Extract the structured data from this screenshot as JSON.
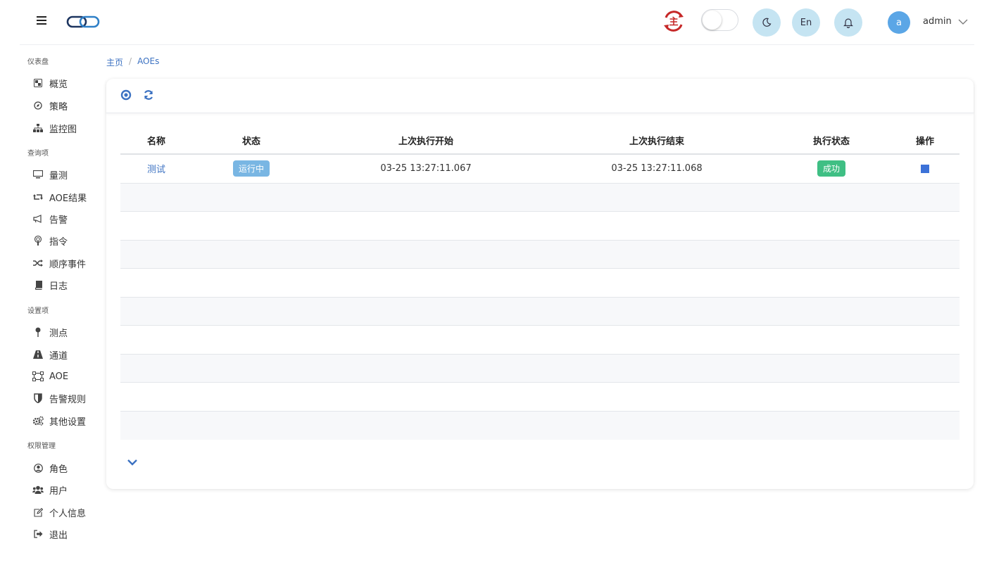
{
  "header": {
    "lang_label": "En",
    "username": "admin",
    "avatar_letter": "a",
    "master_badge": "主"
  },
  "sidebar": {
    "sections": [
      {
        "title": "仪表盘",
        "items": [
          {
            "label": "概览",
            "icon": "dashboard-icon"
          },
          {
            "label": "策略",
            "icon": "compass-icon"
          },
          {
            "label": "监控图",
            "icon": "sitemap-icon"
          }
        ]
      },
      {
        "title": "查询项",
        "items": [
          {
            "label": "量测",
            "icon": "monitor-icon"
          },
          {
            "label": "AOE结果",
            "icon": "retweet-icon"
          },
          {
            "label": "告警",
            "icon": "megaphone-icon"
          },
          {
            "label": "指令",
            "icon": "podcast-icon"
          },
          {
            "label": "顺序事件",
            "icon": "shuffle-icon"
          },
          {
            "label": "日志",
            "icon": "book-icon"
          }
        ]
      },
      {
        "title": "设置项",
        "items": [
          {
            "label": "测点",
            "icon": "pin-icon"
          },
          {
            "label": "通道",
            "icon": "road-icon"
          },
          {
            "label": "AOE",
            "icon": "vector-square-icon"
          },
          {
            "label": "告警规则",
            "icon": "shield-icon"
          },
          {
            "label": "其他设置",
            "icon": "gears-icon"
          }
        ]
      },
      {
        "title": "权限管理",
        "items": [
          {
            "label": "角色",
            "icon": "user-circle-icon"
          },
          {
            "label": "用户",
            "icon": "users-icon"
          },
          {
            "label": "个人信息",
            "icon": "edit-icon"
          },
          {
            "label": "退出",
            "icon": "sign-out-icon"
          }
        ]
      }
    ]
  },
  "breadcrumb": {
    "home": "主页",
    "sep": "/",
    "current": "AOEs"
  },
  "table": {
    "headers": [
      "名称",
      "状态",
      "上次执行开始",
      "上次执行结束",
      "执行状态",
      "操作"
    ],
    "rows": [
      {
        "name": "测试",
        "status": "运行中",
        "start": "03-25 13:27:11.067",
        "end": "03-25 13:27:11.068",
        "exec_status": "成功"
      }
    ]
  },
  "colors": {
    "accent": "#3c72c2",
    "running": "#79b6e3",
    "success": "#3fbf84"
  }
}
